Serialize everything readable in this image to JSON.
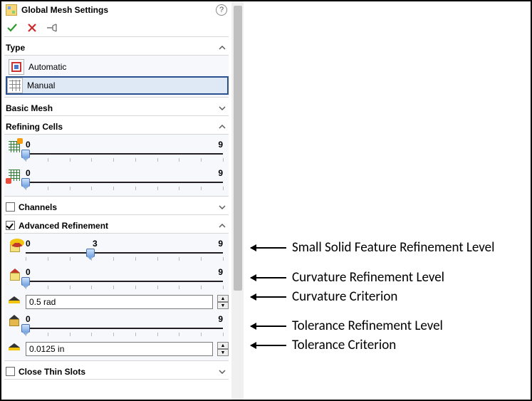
{
  "title": "Global Mesh Settings",
  "groups": {
    "type": {
      "label": "Type",
      "expanded": true,
      "options": {
        "automatic": "Automatic",
        "manual": "Manual"
      },
      "selected": "manual"
    },
    "basic_mesh": {
      "label": "Basic Mesh",
      "expanded": false
    },
    "refining_cells": {
      "label": "Refining Cells",
      "expanded": true,
      "sliders": [
        {
          "min_label": "0",
          "max_label": "9",
          "value": 0,
          "max": 9
        },
        {
          "min_label": "0",
          "max_label": "9",
          "value": 0,
          "max": 9
        }
      ]
    },
    "channels": {
      "label": "Channels",
      "checked": false,
      "expanded": false
    },
    "advanced_refinement": {
      "label": "Advanced Refinement",
      "checked": true,
      "expanded": true,
      "small_solid": {
        "min_label": "0",
        "mid_label": "3",
        "max_label": "9",
        "value": 3,
        "max": 9
      },
      "curvature_level": {
        "min_label": "0",
        "max_label": "9",
        "value": 0,
        "max": 9
      },
      "curvature_criterion": {
        "value": "0.5 rad"
      },
      "tolerance_level": {
        "min_label": "0",
        "max_label": "9",
        "value": 0,
        "max": 9
      },
      "tolerance_criterion": {
        "value": "0.0125 in"
      }
    },
    "close_thin_slots": {
      "label": "Close Thin Slots",
      "checked": false,
      "expanded": false
    }
  },
  "annotations": {
    "small_solid": "Small Solid Feature Refinement Level",
    "curvature_level": "Curvature Refinement Level",
    "curvature_criterion": "Curvature Criterion",
    "tolerance_level": "Tolerance Refinement Level",
    "tolerance_criterion": "Tolerance Criterion"
  }
}
